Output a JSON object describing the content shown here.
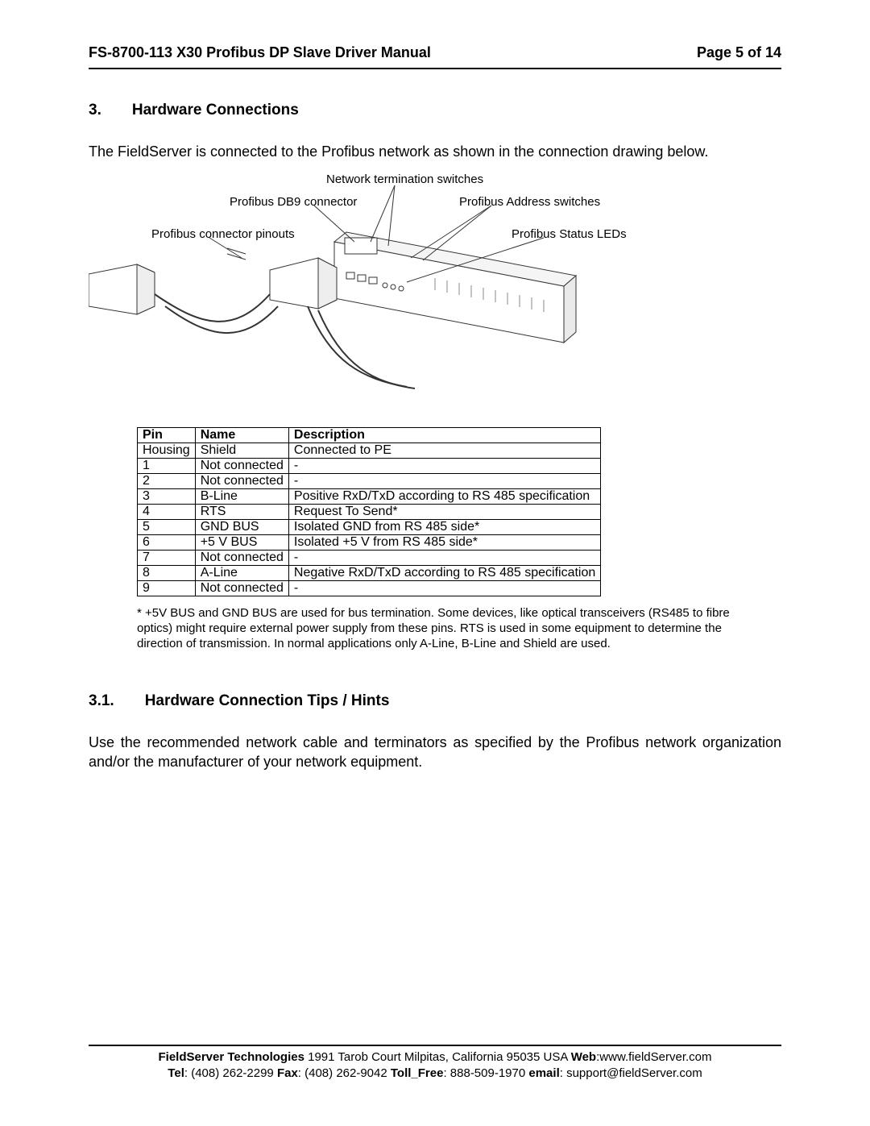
{
  "header": {
    "title": "FS-8700-113 X30 Profibus DP Slave Driver Manual",
    "page": "Page 5 of 14"
  },
  "section1": {
    "num": "3.",
    "title": "Hardware Connections"
  },
  "para1": "The FieldServer is connected to the Profibus network as shown in the connection drawing below.",
  "diagram_labels": {
    "net_term": "Network termination switches",
    "db9": "Profibus DB9 connector",
    "addr": "Profibus Address switches",
    "pinouts": "Profibus connector pinouts",
    "leds": "Profibus Status LEDs"
  },
  "table": {
    "headers": [
      "Pin",
      "Name",
      "Description"
    ],
    "rows": [
      [
        "Housing",
        "Shield",
        "Connected to PE"
      ],
      [
        "1",
        "Not connected",
        "-"
      ],
      [
        "2",
        "Not connected",
        "-"
      ],
      [
        "3",
        "B-Line",
        "Positive RxD/TxD according to RS 485 specification"
      ],
      [
        "4",
        "RTS",
        "Request To Send*"
      ],
      [
        "5",
        "GND BUS",
        "Isolated GND from RS 485 side*"
      ],
      [
        "6",
        "+5 V BUS",
        "Isolated +5 V from RS 485 side*"
      ],
      [
        "7",
        "Not connected",
        "-"
      ],
      [
        "8",
        "A-Line",
        "Negative RxD/TxD according to RS 485 specification"
      ],
      [
        "9",
        "Not connected",
        "-"
      ]
    ]
  },
  "footnote": "* +5V BUS and GND BUS are used for bus termination.  Some devices, like optical transceivers (RS485 to fibre optics) might require external power supply from these pins.  RTS is used in some equipment to determine the direction of transmission.  In normal applications only A-Line, B-Line and Shield are used.",
  "section2": {
    "num": "3.1.",
    "title": "Hardware Connection Tips / Hints"
  },
  "para2": "Use the recommended network cable and terminators as specified by the Profibus network organization and/or the manufacturer of your network equipment.",
  "footer": {
    "l1_a": "FieldServer Technologies",
    "l1_b": " 1991 Tarob Court Milpitas, California 95035 USA  ",
    "l1_c": "Web",
    "l1_d": ":www.fieldServer.com",
    "l2_a": "Tel",
    "l2_b": ": (408) 262-2299   ",
    "l2_c": "Fax",
    "l2_d": ": (408) 262-9042   ",
    "l2_e": "Toll_Free",
    "l2_f": ": 888-509-1970   ",
    "l2_g": "email",
    "l2_h": ": support@fieldServer.com"
  }
}
